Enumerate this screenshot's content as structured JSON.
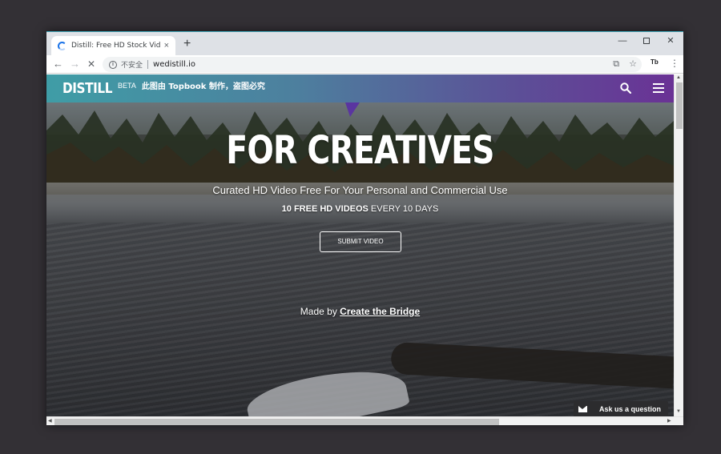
{
  "browser": {
    "tab_title": "Distill: Free HD Stock Video &",
    "tab_close": "×",
    "new_tab": "+",
    "window_min": "—",
    "window_close": "✕",
    "nav_back": "←",
    "nav_forward": "→",
    "nav_stop": "✕",
    "info": "i",
    "security_label": "不安全",
    "url": "wedistill.io",
    "translate_icon": "⧉",
    "bookmark_icon": "☆",
    "extension_label": "Tb",
    "menu_icon": "⋮"
  },
  "site": {
    "logo": "DISTILL",
    "beta": "BETA",
    "notice": "此图由 Topbook 制作，盗图必究"
  },
  "hero": {
    "title": "FOR CREATIVES",
    "subtitle": "Curated HD Video Free For Your Personal and Commercial Use",
    "line2_bold": "10 FREE HD VIDEOS",
    "line2_rest": " EVERY 10 DAYS",
    "submit_label": "SUBMIT VIDEO",
    "madeby_prefix": "Made by ",
    "madeby_link": "Create the Bridge"
  },
  "chat": {
    "label": "Ask us a question"
  },
  "scroll": {
    "up": "▲",
    "down": "▼",
    "left": "◀",
    "right": "▶"
  }
}
